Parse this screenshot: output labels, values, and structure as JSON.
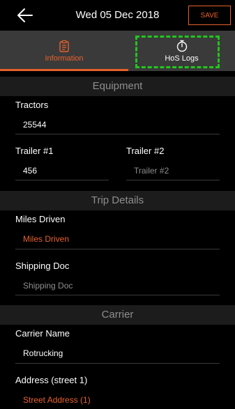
{
  "header": {
    "title": "Wed 05 Dec 2018",
    "save_label": "SAVE"
  },
  "tabs": [
    {
      "label": "Information",
      "icon": "clipboard-icon",
      "active": true
    },
    {
      "label": "HoS Logs",
      "icon": "stopwatch-icon",
      "active": false
    }
  ],
  "sections": {
    "equipment": "Equipment",
    "trip": "Trip Details",
    "carrier": "Carrier"
  },
  "fields": {
    "tractors": {
      "label": "Tractors",
      "value": "25544"
    },
    "trailer1": {
      "label": "Trailer #1",
      "value": "456"
    },
    "trailer2": {
      "label": "Trailer #2",
      "placeholder": "Trailer #2"
    },
    "miles": {
      "label": "Miles Driven",
      "placeholder": "Miles Driven"
    },
    "shipping": {
      "label": "Shipping Doc",
      "placeholder": "Shipping Doc"
    },
    "carrier_name": {
      "label": "Carrier Name",
      "value": "Rotrucking"
    },
    "address1": {
      "label": "Address (street 1)",
      "placeholder": "Street Address (1)"
    }
  },
  "colors": {
    "accent": "#e8612c",
    "highlight": "#22c51e",
    "tab_bar": "#3a3a3a",
    "section_bg": "#1c1c1c",
    "placeholder": "#8e8e8e",
    "value": "#ffffff",
    "required_placeholder": "#e8612c"
  }
}
